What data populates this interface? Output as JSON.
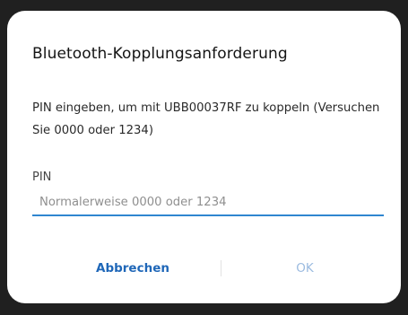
{
  "dialog": {
    "title": "Bluetooth-Kopplungsanforderung",
    "message": "PIN eingeben, um mit UBB00037RF zu koppeln (Versuchen Sie 0000 oder 1234)",
    "pin_label": "PIN",
    "pin_value": "",
    "pin_placeholder": "Normalerweise 0000 oder 1234",
    "cancel_label": "Abbrechen",
    "ok_label": "OK"
  },
  "colors": {
    "accent": "#2f86d0",
    "cancel_text": "#1f67b8",
    "ok_disabled_text": "#9bbbe0"
  }
}
